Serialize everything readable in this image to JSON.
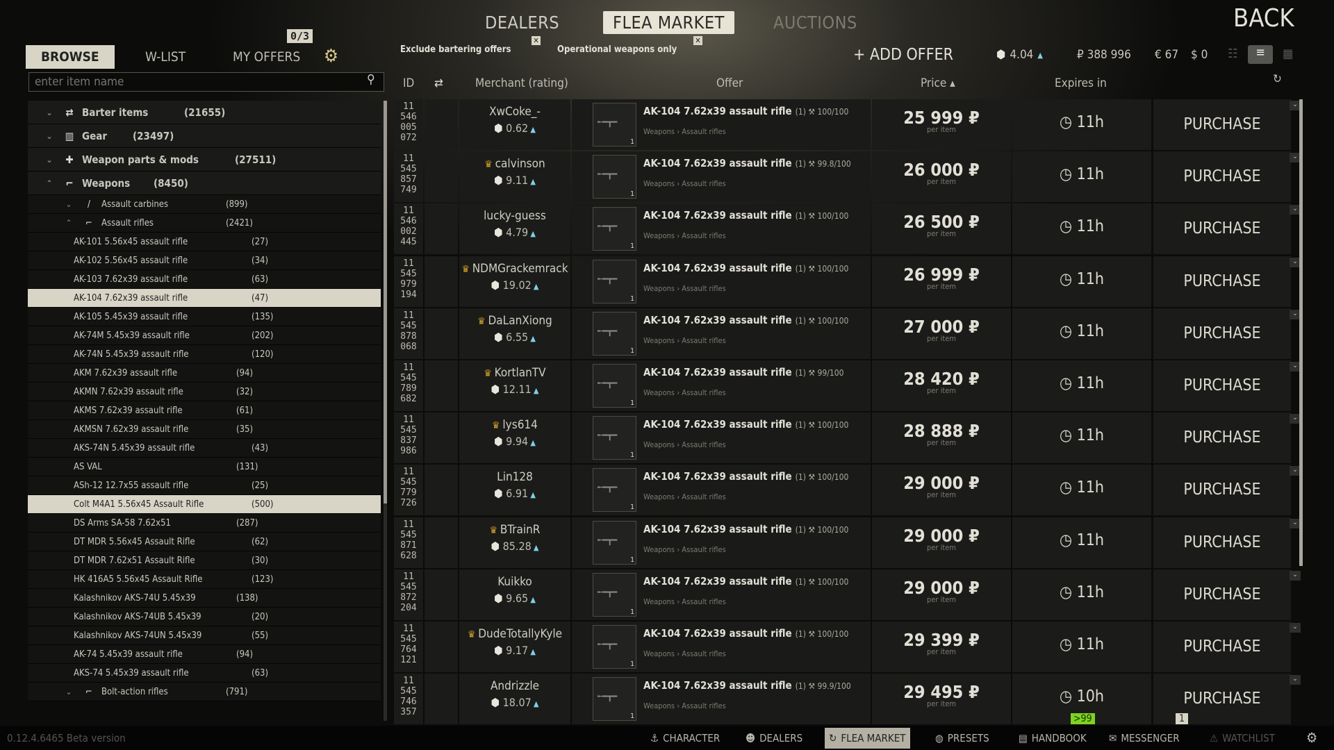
{
  "top_tabs": [
    "DEALERS",
    "FLEA MARKET",
    "AUCTIONS"
  ],
  "back_label": "BACK",
  "sub_tabs": [
    "BROWSE",
    "W-LIST",
    "MY OFFERS"
  ],
  "offers_badge": "0/3",
  "search": {
    "placeholder": "enter item name"
  },
  "filters": [
    {
      "label": "Exclude bartering offers",
      "checked": true
    },
    {
      "label": "Operational weapons only",
      "checked": true
    }
  ],
  "add_offer": "+ ADD OFFER",
  "player": {
    "rating": "4.04",
    "roubles": "₽ 388 996",
    "euros": "€ 67",
    "dollars": "$ 0"
  },
  "columns": {
    "id": "ID",
    "merchant": "Merchant (rating)",
    "offer": "Offer",
    "price": "Price ▴",
    "expires": "Expires in"
  },
  "tree": [
    {
      "label": "Barter items",
      "count": "(21655)",
      "type": "cat",
      "icon": "barter-icon",
      "chev": "⌄"
    },
    {
      "label": "Gear",
      "count": "(23497)",
      "type": "cat",
      "icon": "gear-rig-icon",
      "chev": "⌄"
    },
    {
      "label": "Weapon parts & mods",
      "count": "(27511)",
      "type": "cat",
      "icon": "weapon-parts-icon",
      "chev": "⌄"
    },
    {
      "label": "Weapons",
      "count": "(8450)",
      "type": "cat",
      "icon": "rifle-icon",
      "chev": "⌃"
    },
    {
      "label": "Assault carbines",
      "count": "(899)",
      "type": "sub",
      "icon": "carbine-icon",
      "chev": "⌄"
    },
    {
      "label": "Assault rifles",
      "count": "(2421)",
      "type": "sub",
      "icon": "rifle-icon",
      "chev": "⌃"
    },
    {
      "label": "AK-101 5.56x45 assault rifle",
      "count": "(27)"
    },
    {
      "label": "AK-102 5.56x45 assault rifle",
      "count": "(34)"
    },
    {
      "label": "AK-103 7.62x39 assault rifle",
      "count": "(63)"
    },
    {
      "label": "AK-104 7.62x39 assault rifle",
      "count": "(47)",
      "selected": true
    },
    {
      "label": "AK-105 5.45x39 assault rifle",
      "count": "(135)"
    },
    {
      "label": "AK-74M 5.45x39 assault rifle",
      "count": "(202)"
    },
    {
      "label": "AK-74N 5.45x39 assault rifle",
      "count": "(120)"
    },
    {
      "label": "AKM 7.62x39 assault rifle",
      "count": "(94)"
    },
    {
      "label": "AKMN 7.62x39 assault rifle",
      "count": "(32)"
    },
    {
      "label": "AKMS 7.62x39 assault rifle",
      "count": "(61)"
    },
    {
      "label": "AKMSN 7.62x39 assault rifle",
      "count": "(35)"
    },
    {
      "label": "AKS-74N 5.45x39 assault rifle",
      "count": "(43)"
    },
    {
      "label": "AS VAL",
      "count": "(131)"
    },
    {
      "label": "ASh-12 12.7x55 assault rifle",
      "count": "(25)"
    },
    {
      "label": "Colt M4A1 5.56x45 Assault Rifle",
      "count": "(500)",
      "selected": true
    },
    {
      "label": "DS Arms SA-58 7.62x51",
      "count": "(287)"
    },
    {
      "label": "DT MDR 5.56x45 Assault Rifle",
      "count": "(62)"
    },
    {
      "label": "DT MDR 7.62x51 Assault Rifle",
      "count": "(30)"
    },
    {
      "label": "HK 416A5 5.56x45 Assault Rifle",
      "count": "(123)"
    },
    {
      "label": "Kalashnikov AKS-74U 5.45x39",
      "count": "(138)"
    },
    {
      "label": "Kalashnikov AKS-74UB 5.45x39",
      "count": "(20)"
    },
    {
      "label": "Kalashnikov AKS-74UN 5.45x39",
      "count": "(55)"
    },
    {
      "label": "AK-74 5.45x39 assault rifle",
      "count": "(94)"
    },
    {
      "label": "AKS-74 5.45x39 assault rifle",
      "count": "(63)"
    },
    {
      "label": "Bolt-action rifles",
      "count": "(791)",
      "type": "sub",
      "icon": "bolt-rifle-icon",
      "chev": "⌄"
    }
  ],
  "offers": [
    {
      "id": [
        "11",
        "546",
        "005",
        "072"
      ],
      "merchant": "XwCoke_-",
      "crown": false,
      "rating": "0.62",
      "item": "AK-104 7.62x39 assault rifle",
      "qty": "(1)",
      "durability": "100/100",
      "category": "Weapons › Assault rifles",
      "stack": "1",
      "price": "25 999",
      "per": "per item",
      "expires": "11h",
      "action": "PURCHASE"
    },
    {
      "id": [
        "11",
        "545",
        "857",
        "749"
      ],
      "merchant": "calvinson",
      "crown": true,
      "rating": "9.11",
      "item": "AK-104 7.62x39 assault rifle",
      "qty": "(1)",
      "durability": "99.8/100",
      "category": "Weapons › Assault rifles",
      "stack": "1",
      "price": "26 000",
      "per": "per item",
      "expires": "11h",
      "action": "PURCHASE"
    },
    {
      "id": [
        "11",
        "546",
        "002",
        "445"
      ],
      "merchant": "lucky-guess",
      "crown": false,
      "rating": "4.79",
      "item": "AK-104 7.62x39 assault rifle",
      "qty": "(1)",
      "durability": "100/100",
      "category": "Weapons › Assault rifles",
      "stack": "1",
      "price": "26 500",
      "per": "per item",
      "expires": "11h",
      "action": "PURCHASE"
    },
    {
      "id": [
        "11",
        "545",
        "979",
        "194"
      ],
      "merchant": "NDMGrackemrack",
      "crown": true,
      "rating": "19.02",
      "item": "AK-104 7.62x39 assault rifle",
      "qty": "(1)",
      "durability": "100/100",
      "category": "Weapons › Assault rifles",
      "stack": "1",
      "price": "26 999",
      "per": "per item",
      "expires": "11h",
      "action": "PURCHASE"
    },
    {
      "id": [
        "11",
        "545",
        "878",
        "068"
      ],
      "merchant": "DaLanXiong",
      "crown": true,
      "rating": "6.55",
      "item": "AK-104 7.62x39 assault rifle",
      "qty": "(1)",
      "durability": "100/100",
      "category": "Weapons › Assault rifles",
      "stack": "1",
      "price": "27 000",
      "per": "per item",
      "expires": "11h",
      "action": "PURCHASE"
    },
    {
      "id": [
        "11",
        "545",
        "789",
        "682"
      ],
      "merchant": "KortlanTV",
      "crown": true,
      "rating": "12.11",
      "item": "AK-104 7.62x39 assault rifle",
      "qty": "(1)",
      "durability": "99/100",
      "category": "Weapons › Assault rifles",
      "stack": "1",
      "price": "28 420",
      "per": "per item",
      "expires": "11h",
      "action": "PURCHASE"
    },
    {
      "id": [
        "11",
        "545",
        "837",
        "986"
      ],
      "merchant": "lys614",
      "crown": true,
      "rating": "9.94",
      "item": "AK-104 7.62x39 assault rifle",
      "qty": "(1)",
      "durability": "100/100",
      "category": "Weapons › Assault rifles",
      "stack": "1",
      "price": "28 888",
      "per": "per item",
      "expires": "11h",
      "action": "PURCHASE"
    },
    {
      "id": [
        "11",
        "545",
        "779",
        "726"
      ],
      "merchant": "Lin128",
      "crown": false,
      "rating": "6.91",
      "item": "AK-104 7.62x39 assault rifle",
      "qty": "(1)",
      "durability": "100/100",
      "category": "Weapons › Assault rifles",
      "stack": "1",
      "price": "29 000",
      "per": "per item",
      "expires": "11h",
      "action": "PURCHASE"
    },
    {
      "id": [
        "11",
        "545",
        "871",
        "628"
      ],
      "merchant": "BTrainR",
      "crown": true,
      "rating": "85.28",
      "item": "AK-104 7.62x39 assault rifle",
      "qty": "(1)",
      "durability": "100/100",
      "category": "Weapons › Assault rifles",
      "stack": "1",
      "price": "29 000",
      "per": "per item",
      "expires": "11h",
      "action": "PURCHASE"
    },
    {
      "id": [
        "11",
        "545",
        "872",
        "204"
      ],
      "merchant": "Kuikko",
      "crown": false,
      "rating": "9.65",
      "item": "AK-104 7.62x39 assault rifle",
      "qty": "(1)",
      "durability": "100/100",
      "category": "Weapons › Assault rifles",
      "stack": "1",
      "price": "29 000",
      "per": "per item",
      "expires": "11h",
      "action": "PURCHASE"
    },
    {
      "id": [
        "11",
        "545",
        "764",
        "121"
      ],
      "merchant": "DudeTotallyKyle",
      "crown": true,
      "rating": "9.17",
      "item": "AK-104 7.62x39 assault rifle",
      "qty": "(1)",
      "durability": "100/100",
      "category": "Weapons › Assault rifles",
      "stack": "1",
      "price": "29 399",
      "per": "per item",
      "expires": "11h",
      "action": "PURCHASE"
    },
    {
      "id": [
        "11",
        "545",
        "746",
        "357"
      ],
      "merchant": "Andrizzle",
      "crown": false,
      "rating": "18.07",
      "item": "AK-104 7.62x39 assault rifle",
      "qty": "(1)",
      "durability": "99.9/100",
      "category": "Weapons › Assault rifles",
      "stack": "1",
      "price": "29 495",
      "per": "per item",
      "expires": "10h",
      "action": "PURCHASE"
    }
  ],
  "notifications": {
    "messages": ">99",
    "friends": "1"
  },
  "version": "0.12.4.6465 Beta version",
  "bottom_nav": [
    {
      "label": "CHARACTER",
      "icon": "character-icon"
    },
    {
      "label": "DEALERS",
      "icon": "dealers-icon"
    },
    {
      "label": "FLEA MARKET",
      "icon": "flea-market-icon",
      "active": true
    },
    {
      "label": "PRESETS",
      "icon": "presets-icon"
    },
    {
      "label": "HANDBOOK",
      "icon": "handbook-icon"
    },
    {
      "label": "MESSENGER",
      "icon": "messenger-icon"
    },
    {
      "label": "WATCHLIST",
      "icon": "warning-icon",
      "disabled": true
    }
  ],
  "colors": {
    "accent": "#d8d5c6",
    "rating_up": "#7fd0e6",
    "crown": "#d4a12a",
    "notify": "#7ed321"
  }
}
